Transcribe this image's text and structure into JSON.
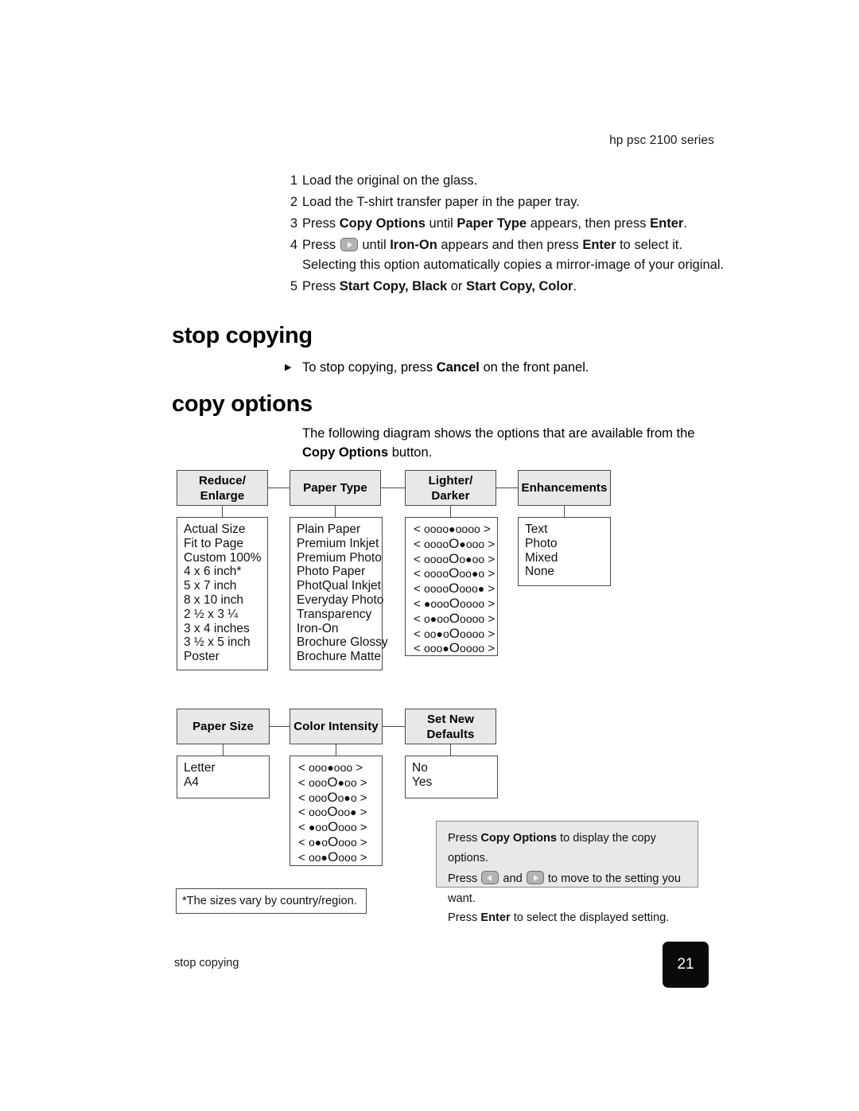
{
  "header": {
    "running_head": "hp psc 2100 series"
  },
  "steps": [
    {
      "num": "1",
      "parts": [
        {
          "t": "Load the original on the glass.",
          "b": false
        }
      ]
    },
    {
      "num": "2",
      "parts": [
        {
          "t": "Load the T-shirt transfer paper in the paper tray.",
          "b": false
        }
      ]
    },
    {
      "num": "3",
      "parts": [
        {
          "t": "Press ",
          "b": false
        },
        {
          "t": "Copy Options",
          "b": true
        },
        {
          "t": " until ",
          "b": false
        },
        {
          "t": "Paper Type",
          "b": true
        },
        {
          "t": " appears, then press ",
          "b": false
        },
        {
          "t": "Enter",
          "b": true
        },
        {
          "t": ".",
          "b": false
        }
      ]
    },
    {
      "num": "4",
      "parts": [
        {
          "t": "Press ",
          "b": false
        },
        {
          "t": "[right-arrow-key]",
          "b": false
        },
        {
          "t": " until ",
          "b": false
        },
        {
          "t": "Iron-On",
          "b": true
        },
        {
          "t": " appears and then press ",
          "b": false
        },
        {
          "t": "Enter",
          "b": true
        },
        {
          "t": " to select it.",
          "b": false
        }
      ],
      "continuation": "Selecting this option automatically copies a mirror-image of your original."
    },
    {
      "num": "5",
      "parts": [
        {
          "t": "Press ",
          "b": false
        },
        {
          "t": "Start Copy, Black",
          "b": true
        },
        {
          "t": " or ",
          "b": false
        },
        {
          "t": "Start Copy, Color",
          "b": true
        },
        {
          "t": ".",
          "b": false
        }
      ]
    }
  ],
  "sections": {
    "stop_copying_heading": "stop copying",
    "stop_copying_bullet": [
      {
        "t": "To stop copying, press ",
        "b": false
      },
      {
        "t": "Cancel",
        "b": true
      },
      {
        "t": " on the front panel.",
        "b": false
      }
    ],
    "copy_options_heading": "copy options",
    "copy_options_intro": [
      {
        "t": "The following diagram shows the options that are available from the ",
        "b": false
      },
      {
        "t": "Copy Options",
        "b": true
      },
      {
        "t": " button.",
        "b": false
      }
    ]
  },
  "diagram": {
    "row1": [
      {
        "header": "Reduce/\nEnlarge",
        "header_lines": [
          "Reduce/",
          "Enlarge"
        ],
        "items": [
          "Actual Size",
          "Fit to Page",
          "Custom 100%",
          "4 x 6 inch*",
          "5 x 7 inch",
          "8 x 10 inch",
          "2 ½ x 3 ¼",
          "3 x 4 inches",
          "3 ½ x 5 inch",
          "Poster"
        ]
      },
      {
        "header": "Paper Type",
        "header_lines": [
          "Paper Type"
        ],
        "items": [
          "Plain Paper",
          "Premium Inkjet",
          "Premium Photo",
          "Photo Paper",
          "PhotQual Inkjet",
          "Everyday Photo",
          "Transparency",
          "Iron-On",
          "Brochure Glossy",
          "Brochure Matte"
        ]
      },
      {
        "header": "Lighter/\nDarker",
        "header_lines": [
          "Lighter/",
          "Darker"
        ],
        "dot_rows": [
          "oooo@oooo",
          "ooooO@ooo",
          "ooooOo@oo",
          "ooooOoo@o",
          "ooooOooo@",
          "@oooOoooo",
          "o@ooOoooo",
          "oo@oOoooo",
          "ooo@Ooooo"
        ]
      },
      {
        "header": "Enhancements",
        "header_lines": [
          "Enhancements"
        ],
        "items": [
          "Text",
          "Photo",
          "Mixed",
          "None"
        ]
      }
    ],
    "row2": [
      {
        "header": "Paper Size",
        "header_lines": [
          "Paper Size"
        ],
        "items": [
          "Letter",
          "A4"
        ]
      },
      {
        "header": "Color Intensity",
        "header_lines": [
          "Color Intensity"
        ],
        "dot_rows": [
          "ooo@ooo",
          "oooO@oo",
          "oooOo@o",
          "oooOoo@",
          "@ooOooo",
          "o@oOooo",
          "oo@Oooo"
        ]
      },
      {
        "header": "Set New\nDefaults",
        "header_lines": [
          "Set New",
          "Defaults"
        ],
        "items": [
          "No",
          "Yes"
        ]
      }
    ],
    "instructions": [
      [
        {
          "t": "Press ",
          "b": false
        },
        {
          "t": "Copy Options",
          "b": true
        },
        {
          "t": " to display the copy options.",
          "b": false
        }
      ],
      [
        {
          "t": "Press ",
          "b": false
        },
        {
          "t": "[left-arrow-key]",
          "b": false
        },
        {
          "t": " and ",
          "b": false
        },
        {
          "t": "[right-arrow-key]",
          "b": false
        },
        {
          "t": " to move to the setting you want.",
          "b": false
        }
      ],
      [
        {
          "t": "Press ",
          "b": false
        },
        {
          "t": "Enter",
          "b": true
        },
        {
          "t": " to select the displayed setting.",
          "b": false
        }
      ]
    ],
    "footnote": "*The sizes vary by country/region.",
    "dot_legend": {
      "small_open": "o",
      "large_open": "O",
      "filled": "●",
      "left_angle": "<",
      "right_angle": ">"
    }
  },
  "footer": {
    "section_label": "stop copying",
    "page_number": "21"
  },
  "colors": {
    "box_fill": "#e8e8e8",
    "box_border": "#4a4a4a",
    "page_num_bg": "#0a0a0a",
    "text": "#111111"
  }
}
